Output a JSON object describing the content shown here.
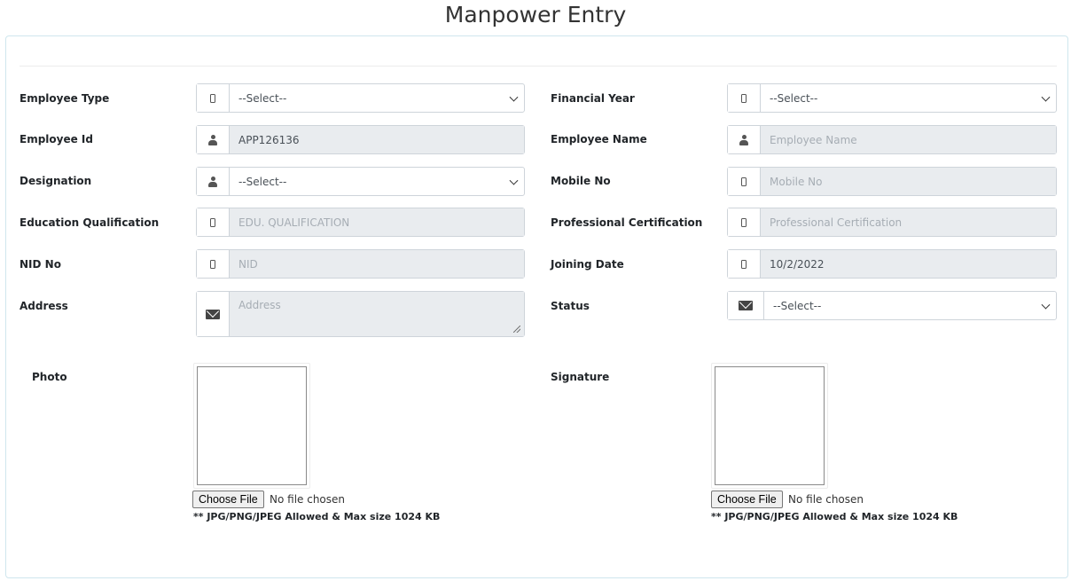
{
  "page": {
    "title": "Manpower Entry"
  },
  "fields": {
    "employee_type": {
      "label": "Employee Type",
      "value": "--Select--"
    },
    "financial_year": {
      "label": "Financial Year",
      "value": "--Select--"
    },
    "employee_id": {
      "label": "Employee Id",
      "value": "APP126136"
    },
    "employee_name": {
      "label": "Employee Name",
      "placeholder": "Employee Name"
    },
    "designation": {
      "label": "Designation",
      "value": "--Select--"
    },
    "mobile_no": {
      "label": "Mobile No",
      "placeholder": "Mobile No"
    },
    "education": {
      "label": "Education Qualification",
      "placeholder": "EDU. QUALIFICATION"
    },
    "certification": {
      "label": "Professional Certification",
      "placeholder": "Professional Certification"
    },
    "nid": {
      "label": "NID No",
      "placeholder": "NID"
    },
    "joining_date": {
      "label": "Joining Date",
      "value": "10/2/2022"
    },
    "address": {
      "label": "Address",
      "placeholder": "Address"
    },
    "status": {
      "label": "Status",
      "value": "--Select--"
    }
  },
  "uploads": {
    "photo": {
      "label": "Photo",
      "button": "Choose File",
      "status": "No file chosen",
      "hint": "** JPG/PNG/JPEG Allowed & Max size 1024 KB"
    },
    "signature": {
      "label": "Signature",
      "button": "Choose File",
      "status": "No file chosen",
      "hint": "** JPG/PNG/JPEG Allowed & Max size 1024 KB"
    }
  },
  "icons": {
    "phone": "mobile-phone-icon",
    "user": "user-icon",
    "mail": "envelope-icon",
    "dropdown": "chevron-down-icon"
  }
}
